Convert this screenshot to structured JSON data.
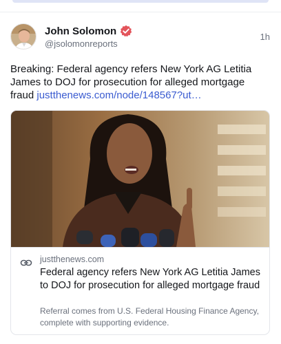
{
  "post": {
    "author_name": "John Solomon",
    "author_handle": "@jsolomonreports",
    "timestamp": "1h",
    "body_text": "Breaking: Federal agency refers New York AG Letitia James to DOJ for prosecution for alleged mortgage fraud ",
    "body_link": "justthenews.com/node/148567?ut…",
    "verified_icon": "verified-badge-icon"
  },
  "link_card": {
    "domain": "justthenews.com",
    "title": "Federal agency refers New York AG Letitia James to DOJ for prosecution for alleged mortgage fraud",
    "description": "Referral comes from U.S. Federal Housing Finance Agency, complete with supporting evidence.",
    "icon": "link-icon"
  },
  "colors": {
    "link": "#3a5bd0",
    "verified": "#e3545b",
    "muted": "#6a707c"
  }
}
